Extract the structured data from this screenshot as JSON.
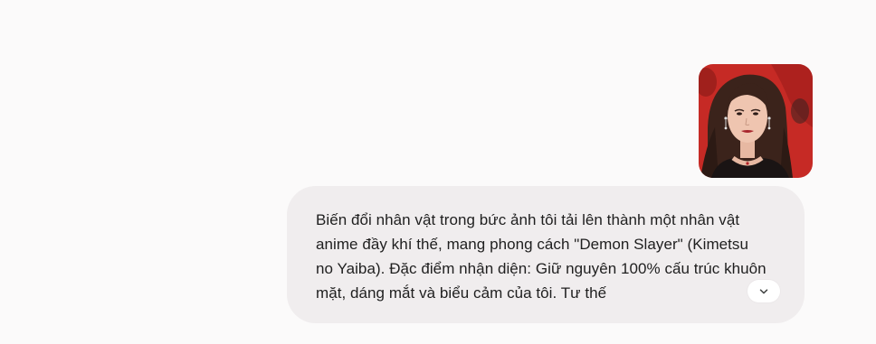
{
  "user_message": {
    "image": {
      "alt": "uploaded portrait photo",
      "icon": "photo-thumbnail"
    },
    "text": "Biến đổi nhân vật trong bức ảnh tôi tải lên thành một nhân vật anime đầy khí thế, mang phong cách \"Demon Slayer\" (Kimetsu no Yaiba). Đặc điểm nhận diện: Giữ nguyên 100% cấu trúc khuôn mặt, dáng mắt và biểu cảm của tôi. Tư thế",
    "expand_icon": "chevron-down-icon"
  },
  "colors": {
    "page_background": "#fbfafa",
    "bubble_background": "#f0edee",
    "text": "#1f1f1f",
    "button_background": "#ffffff"
  }
}
